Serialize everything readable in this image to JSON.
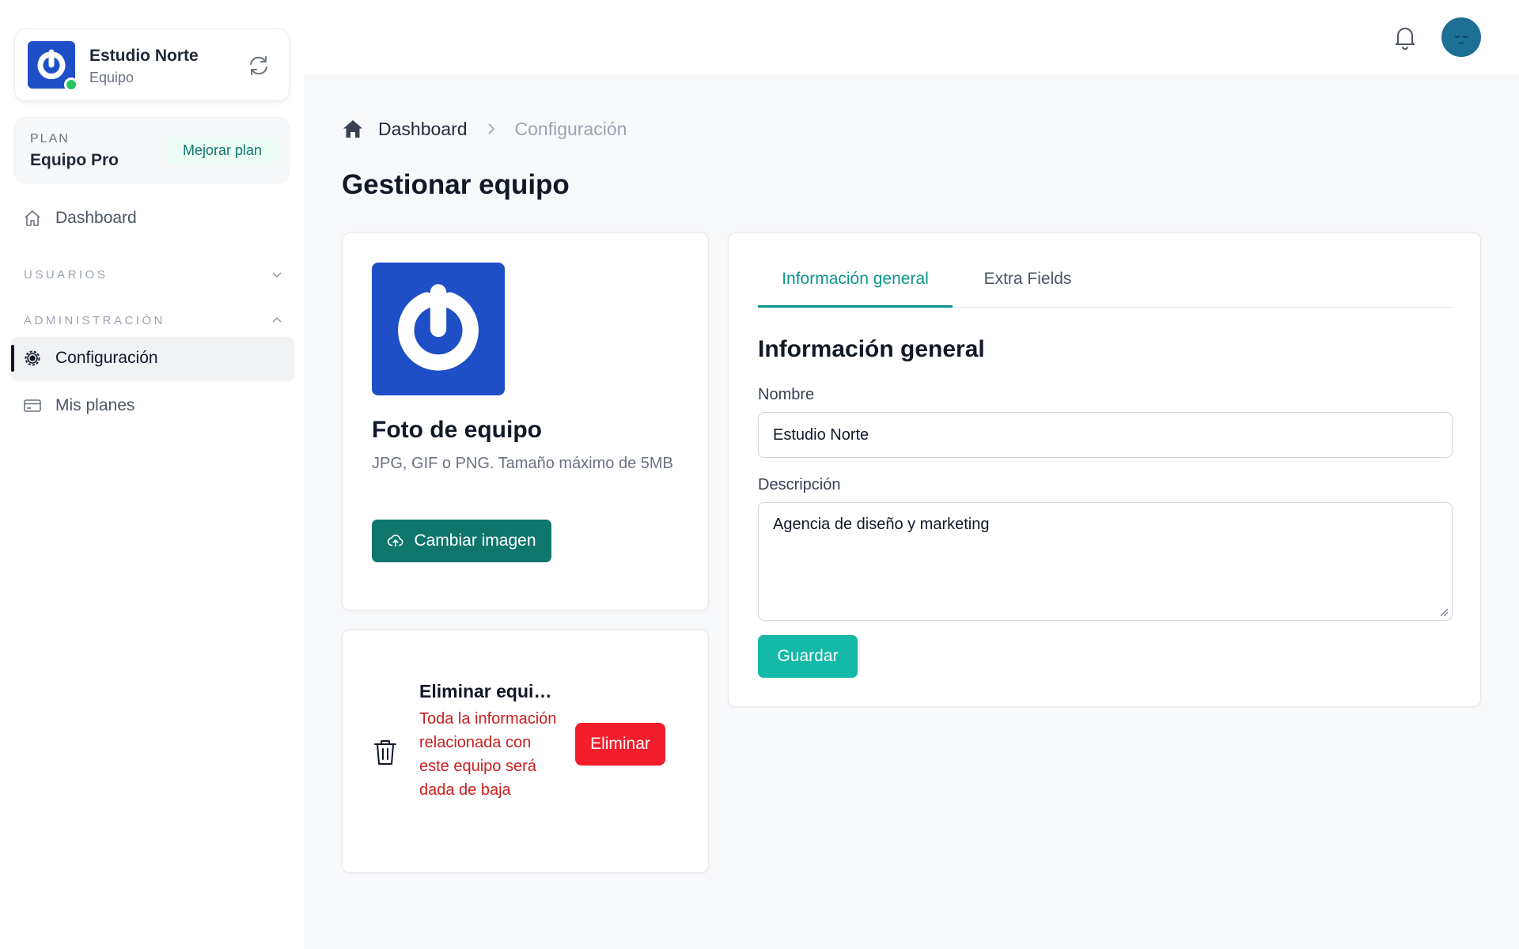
{
  "team": {
    "name": "Estudio Norte",
    "subtitle": "Equipo"
  },
  "plan": {
    "label": "PLAN",
    "name": "Equipo Pro",
    "upgrade_label": "Mejorar plan"
  },
  "sidebar": {
    "dashboard_label": "Dashboard",
    "sections": [
      {
        "label": "USUARIOS",
        "expanded": false
      },
      {
        "label": "ADMINISTRACIÓN",
        "expanded": true
      }
    ],
    "items": [
      {
        "label": "Configuración",
        "active": true
      },
      {
        "label": "Mis planes",
        "active": false
      }
    ]
  },
  "breadcrumb": {
    "home": "Dashboard",
    "current": "Configuración"
  },
  "page_title": "Gestionar equipo",
  "photo": {
    "title": "Foto de equipo",
    "hint": "JPG, GIF o PNG. Tamaño máximo de 5MB",
    "change_label": "Cambiar imagen"
  },
  "delete": {
    "title": "Eliminar equipo",
    "description": "Toda la información relacionada con este equipo será dada de baja",
    "button_label": "Eliminar"
  },
  "info": {
    "tabs": [
      "Información general",
      "Extra Fields"
    ],
    "active_tab": 0,
    "section_title": "Información general",
    "name_label": "Nombre",
    "name_value": "Estudio Norte",
    "description_label": "Descripción",
    "description_value": "Agencia de diseño y marketing",
    "save_label": "Guardar"
  },
  "colors": {
    "brand_blue": "#1f4fc7",
    "primary_dark": "#0f766e",
    "primary": "#14b8a6",
    "danger": "#f31d2b",
    "online": "#22c55e"
  },
  "icons": [
    "switch-icon",
    "home-icon",
    "gear-icon",
    "credit-card-icon",
    "bell-icon",
    "chevron-right-icon",
    "cloud-upload-icon",
    "trash-icon"
  ]
}
